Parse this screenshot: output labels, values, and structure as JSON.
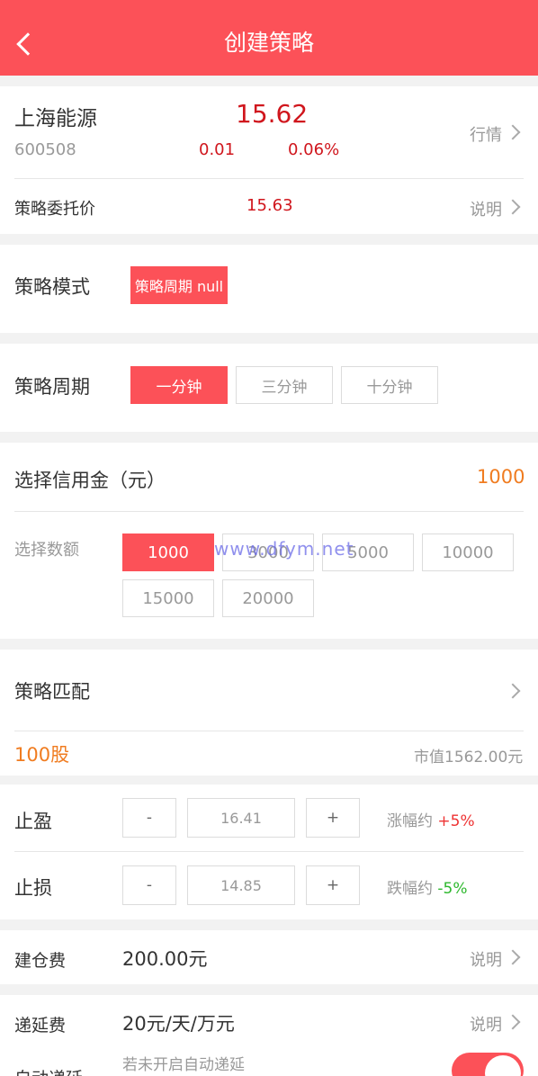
{
  "header": {
    "title": "创建策略"
  },
  "stock": {
    "name": "上海能源",
    "code": "600508",
    "price": "15.62",
    "change": "0.01",
    "change_pct": "0.06%",
    "quote_link": "行情"
  },
  "entrust": {
    "label": "策略委托价",
    "price": "15.63",
    "explain": "说明"
  },
  "mode": {
    "label": "策略模式",
    "option": "策略周期 null"
  },
  "period": {
    "label": "策略周期",
    "options": [
      "一分钟",
      "三分钟",
      "十分钟"
    ],
    "selected": 0
  },
  "credit": {
    "label": "选择信用金（元）",
    "value": "1000",
    "amount_label": "选择数额",
    "amounts": [
      "1000",
      "3000",
      "5000",
      "10000",
      "15000",
      "20000"
    ],
    "selected": 0
  },
  "watermark": "www.dfym.net",
  "match": {
    "label": "策略匹配",
    "shares": "100股",
    "market_value": "市值1562.00元"
  },
  "take_profit": {
    "label": "止盈",
    "minus": "-",
    "value": "16.41",
    "plus": "+",
    "hint": "涨幅约",
    "pct": "+5%"
  },
  "stop_loss": {
    "label": "止损",
    "minus": "-",
    "value": "14.85",
    "plus": "+",
    "hint": "跌幅约",
    "pct": "-5%"
  },
  "open_fee": {
    "label": "建仓费",
    "value": "200.00元",
    "explain": "说明"
  },
  "defer_fee": {
    "label": "递延费",
    "value": "20元/天/万元",
    "explain": "说明"
  },
  "auto_defer": {
    "label": "自动递延",
    "hint": "若未开启自动递延",
    "enabled": true
  },
  "colors": {
    "accent": "#fc5158",
    "up": "#d0161d",
    "down": "#2db82d",
    "highlight": "#f07c20"
  }
}
